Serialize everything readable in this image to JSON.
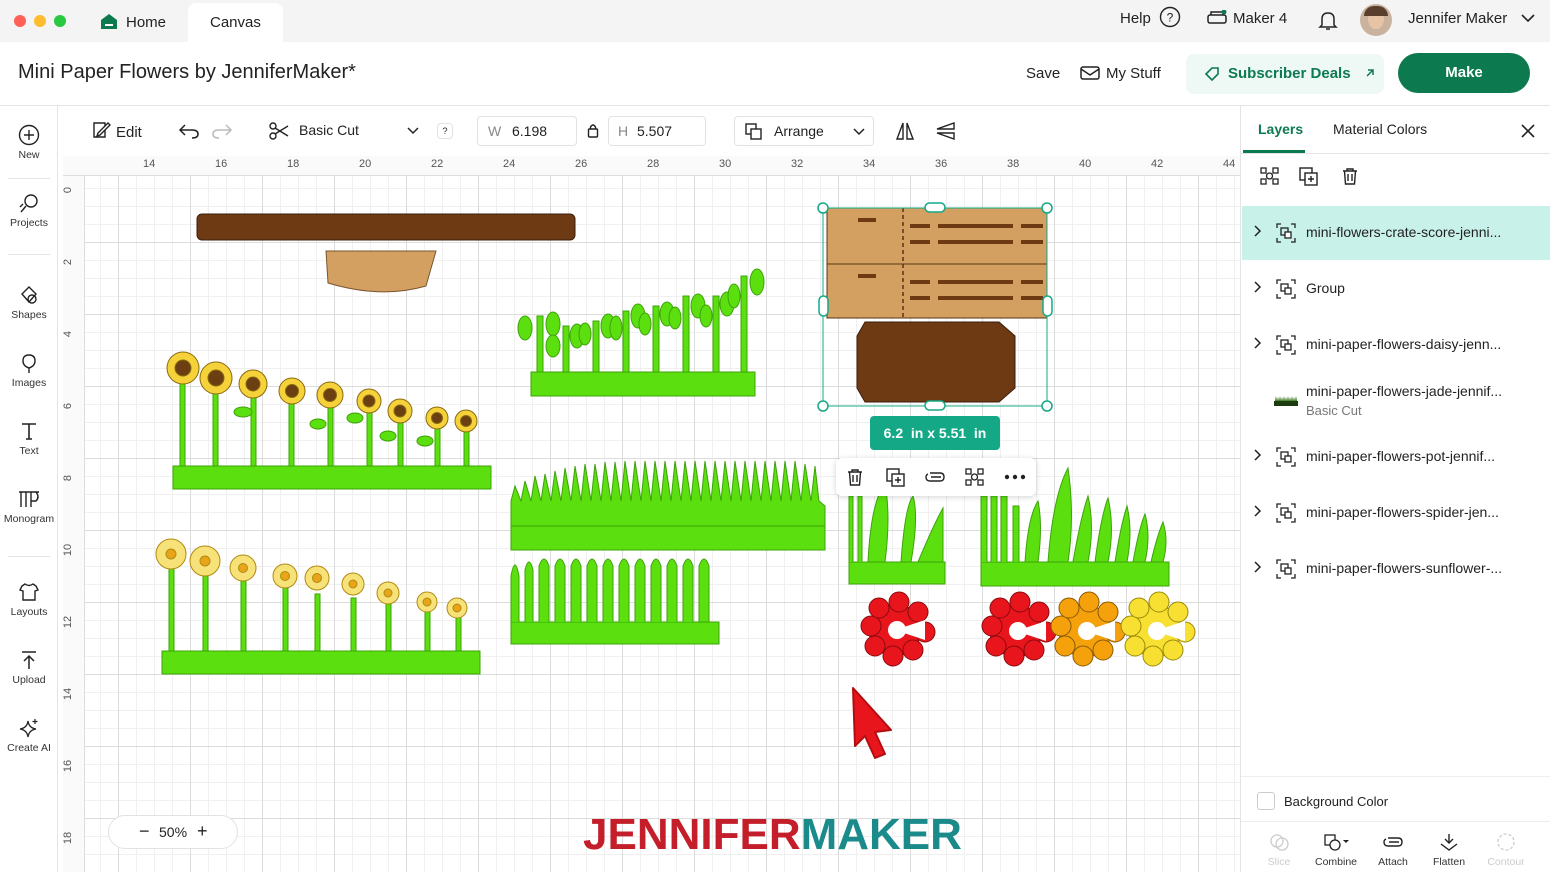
{
  "window": {
    "tabs": [
      {
        "label": "Home"
      },
      {
        "label": "Canvas"
      }
    ]
  },
  "topbar": {
    "help": "Help",
    "machine": "Maker 4",
    "user": "Jennifer Maker"
  },
  "header": {
    "title": "Mini Paper Flowers by JenniferMaker*",
    "save": "Save",
    "my_stuff": "My Stuff",
    "deals": "Subscriber Deals",
    "make": "Make"
  },
  "rail": [
    {
      "label": "New",
      "icon": "plus-circle-icon"
    },
    {
      "label": "Projects",
      "icon": "projects-icon"
    },
    {
      "label": "Shapes",
      "icon": "shapes-icon"
    },
    {
      "label": "Images",
      "icon": "images-icon"
    },
    {
      "label": "Text",
      "icon": "text-icon"
    },
    {
      "label": "Monogram",
      "icon": "monogram-icon"
    },
    {
      "label": "Layouts",
      "icon": "layouts-icon"
    },
    {
      "label": "Upload",
      "icon": "upload-icon"
    },
    {
      "label": "Create AI",
      "icon": "sparkle-icon"
    }
  ],
  "toolbar": {
    "edit": "Edit",
    "operation": "Basic Cut",
    "help_q": "?",
    "w_label": "W",
    "w_value": "6.198",
    "h_label": "H",
    "h_value": "5.507",
    "arrange": "Arrange"
  },
  "ruler": {
    "top": [
      "14",
      "16",
      "18",
      "20",
      "22",
      "24",
      "26",
      "28",
      "30",
      "32",
      "34",
      "36",
      "38",
      "40",
      "42",
      "44"
    ],
    "left": [
      "0",
      "2",
      "4",
      "6",
      "8",
      "10",
      "12",
      "14",
      "16",
      "18"
    ]
  },
  "canvas": {
    "size_badge": "6.2  in x 5.51  in",
    "watermark": "JENNIFERMAKER",
    "zoom": "50%"
  },
  "panel": {
    "tabs": {
      "layers": "Layers",
      "material": "Material Colors"
    },
    "layers": [
      {
        "name": "mini-flowers-crate-score-jenni...",
        "sub": "",
        "selected": true
      },
      {
        "name": "Group",
        "sub": ""
      },
      {
        "name": "mini-paper-flowers-daisy-jenn...",
        "sub": ""
      },
      {
        "name": "mini-paper-flowers-jade-jennif...",
        "sub": "Basic Cut"
      },
      {
        "name": "mini-paper-flowers-pot-jennif...",
        "sub": ""
      },
      {
        "name": "mini-paper-flowers-spider-jen...",
        "sub": ""
      },
      {
        "name": "mini-paper-flowers-sunflower-...",
        "sub": ""
      }
    ],
    "background_color": "Background Color",
    "bottom": {
      "slice": "Slice",
      "combine": "Combine",
      "attach": "Attach",
      "flatten": "Flatten",
      "contour": "Contour"
    }
  },
  "colors": {
    "accent": "#0c7a4e",
    "teal": "#14a886",
    "grass": "#5cdf0f",
    "brown": "#6e3a14",
    "tan": "#d4a062"
  }
}
